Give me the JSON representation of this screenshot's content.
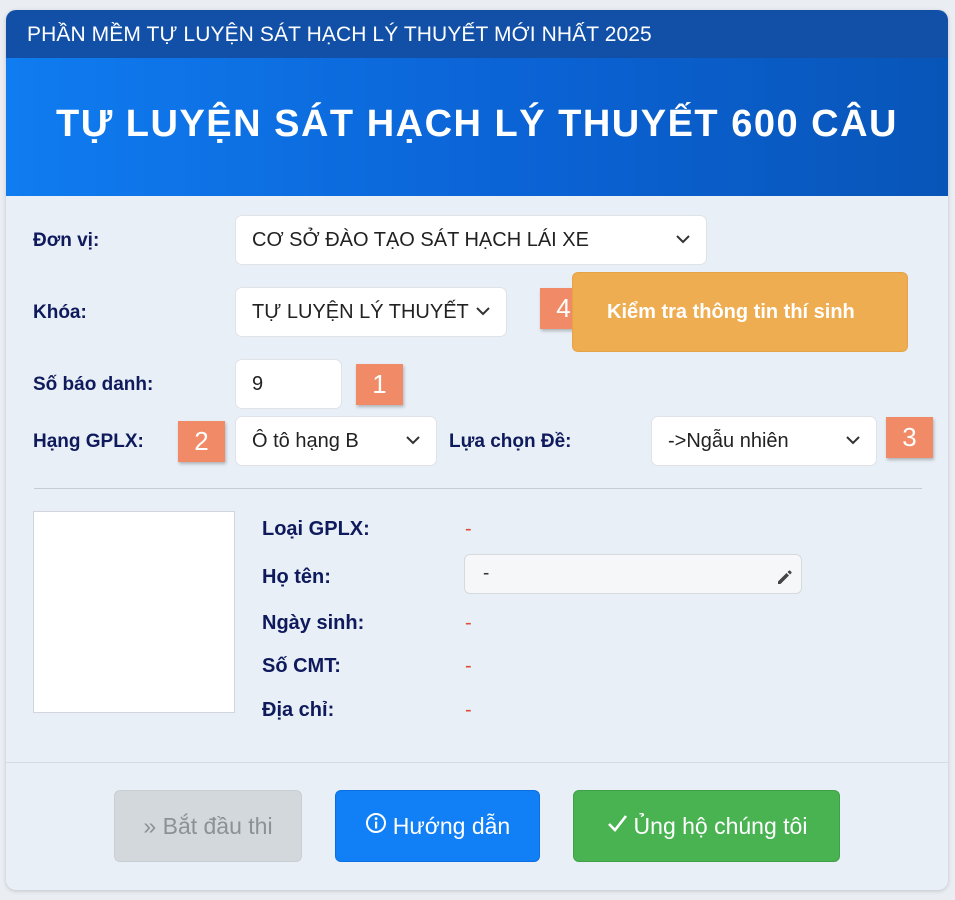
{
  "header": {
    "top_title": "PHẦN MỀM TỰ LUYỆN SÁT HẠCH LÝ THUYẾT MỚI NHẤT 2025",
    "banner_title": "TỰ LUYỆN SÁT HẠCH LÝ THUYẾT 600 CÂU"
  },
  "form": {
    "don_vi": {
      "label": "Đơn vị:",
      "value": "CƠ SỞ ĐÀO TẠO SÁT HẠCH LÁI XE"
    },
    "khoa": {
      "label": "Khóa:",
      "value": "TỰ LUYỆN LÝ THUYẾT"
    },
    "so_bao_danh": {
      "label": "Số báo danh:",
      "value": "9"
    },
    "hang_gplx": {
      "label": "Hạng GPLX:",
      "value": "Ô tô hạng B"
    },
    "lua_chon_de": {
      "label": "Lựa chọn Đề:",
      "value": "->Ngẫu nhiên"
    },
    "check_button_label": "Kiểm tra thông tin thí sinh"
  },
  "badges": [
    "1",
    "2",
    "3",
    "4"
  ],
  "info": {
    "loai_gplx": {
      "label": "Loại GPLX:",
      "value": "-"
    },
    "ho_ten": {
      "label": "Họ tên:",
      "value": "-"
    },
    "ngay_sinh": {
      "label": "Ngày sinh:",
      "value": "-"
    },
    "so_cmt": {
      "label": "Số CMT:",
      "value": "-"
    },
    "dia_chi": {
      "label": "Địa chỉ:",
      "value": "-"
    }
  },
  "buttons": {
    "start": "» Bắt đầu thi",
    "guide": "Hướng dẫn",
    "support": "Ủng hộ chúng tôi"
  },
  "icons": {
    "chevron": "chevron-down-icon",
    "pencil": "pencil-icon",
    "info": "info-circle-icon",
    "check": "check-icon"
  },
  "colors": {
    "top_bar": "#1250a8",
    "banner": "#0b63d5",
    "badge": "#f08a67",
    "check_button": "#efad52",
    "guide_button": "#1180f6",
    "support_button": "#49b352",
    "disabled_button": "#d3d8dc",
    "label_text": "#0f1a5c",
    "empty_value": "#e04b36"
  }
}
